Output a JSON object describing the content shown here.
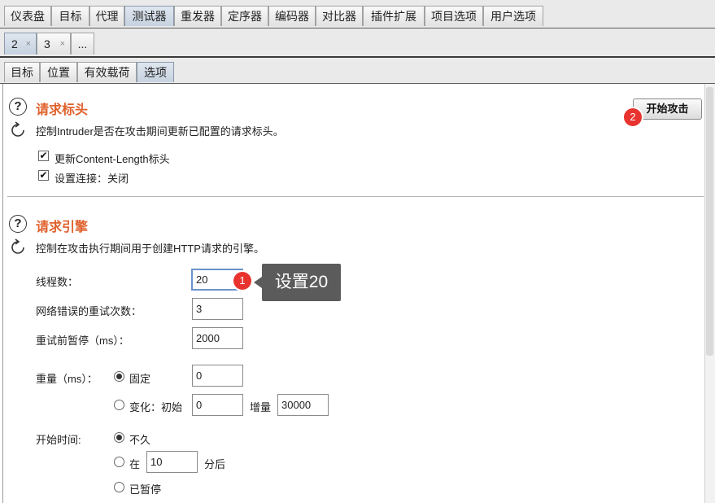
{
  "top_tabs": [
    "仪表盘",
    "目标",
    "代理",
    "测试器",
    "重发器",
    "定序器",
    "编码器",
    "对比器",
    "插件扩展",
    "项目选项",
    "用户选项"
  ],
  "intruder_tabs": [
    {
      "label": "2",
      "close": "×"
    },
    {
      "label": "3",
      "close": "×"
    },
    {
      "label": "..."
    }
  ],
  "sub_tabs": [
    "目标",
    "位置",
    "有效载荷",
    "选项"
  ],
  "start_attack": {
    "badge": "2",
    "label": "开始攻击"
  },
  "request_headers": {
    "help": "?",
    "title": "请求标头",
    "description": "控制Intruder是否在攻击期间更新已配置的请求标头。",
    "options": [
      {
        "label": "更新Content-Length标头",
        "checked": true
      },
      {
        "label": "设置连接：关闭",
        "checked": true
      }
    ]
  },
  "request_engine": {
    "help": "?",
    "title": "请求引擎",
    "description": "控制在攻击执行期间用于创建HTTP请求的引擎。",
    "threads_label": "线程数：",
    "threads_value": "20",
    "retries_label": "网络错误的重试次数：",
    "retries_value": "3",
    "pause_label": "重试前暂停（ms）：",
    "pause_value": "2000",
    "throttle_label": "重量（ms）：",
    "throttle_fixed_label": "固定",
    "throttle_fixed_value": "0",
    "throttle_variable_label": "变化：初始",
    "throttle_variable_initial": "0",
    "throttle_increment_label": "增量",
    "throttle_increment_value": "30000",
    "start_time_label": "开始时间:",
    "start_immediately_label": "不久",
    "start_in_label": "在",
    "start_in_value": "10",
    "start_in_suffix": "分后",
    "start_paused_label": "已暂停"
  },
  "annotation": {
    "badge": "1",
    "tooltip": "设置20"
  },
  "colors": {
    "section_title": "#e0612c",
    "badge": "#e8332f",
    "tooltip_bg": "#5b5b5b",
    "active_tab": "#c6d2e0"
  }
}
